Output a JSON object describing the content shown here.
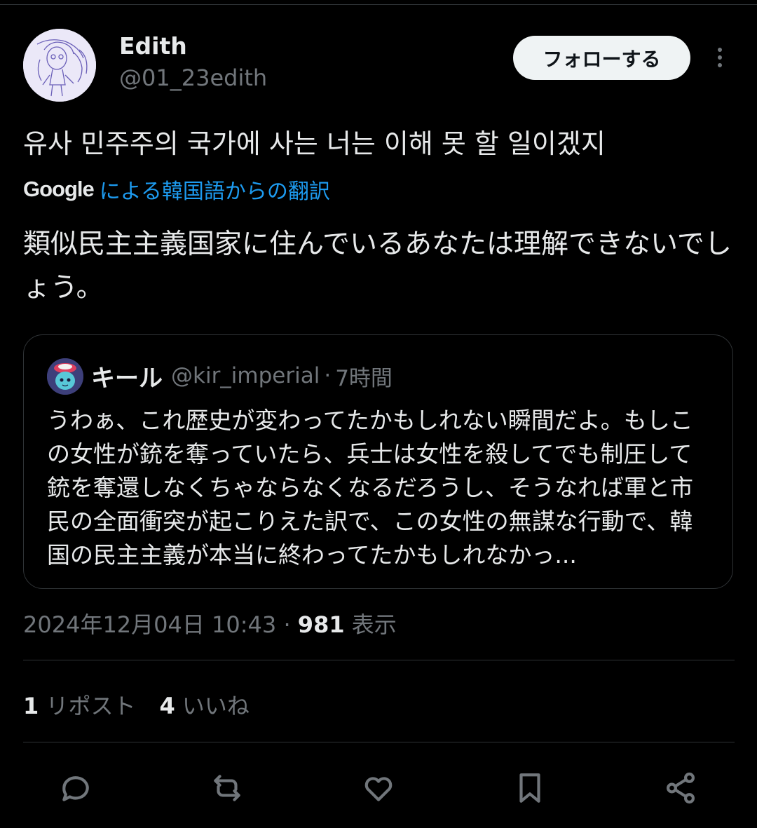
{
  "author": {
    "name": "Edith",
    "handle": "@01_23edith"
  },
  "follow_label": "フォローする",
  "tweet": {
    "original_text": "유사 민주주의 국가에 사는 너는 이해 못 할 일이겠지",
    "translation_provider": "Google",
    "translation_link": "による韓国語からの翻訳",
    "translated_text": "類似民主主義国家に住んでいるあなたは理解できないでしょう。"
  },
  "quote": {
    "name": "キール",
    "handle": "@kir_imperial",
    "separator": "·",
    "time": "7時間",
    "text": "うわぁ、これ歴史が変わってたかもしれない瞬間だよ。もしこの女性が銃を奪っていたら、兵士は女性を殺してでも制圧して銃を奪還しなくちゃならなくなるだろうし、そうなれば軍と市民の全面衝突が起こりえた訳で、この女性の無謀な行動で、韓国の民主主義が本当に終わってたかもしれなかっ..."
  },
  "meta": {
    "timestamp": "2024年12月04日 10:43",
    "separator": " · ",
    "views_count": "981",
    "views_label": " 表示"
  },
  "stats": {
    "reposts_count": "1",
    "reposts_label": " リポスト",
    "likes_count": "4",
    "likes_label": " いいね"
  },
  "actions": [
    "reply-icon",
    "repost-icon",
    "like-icon",
    "bookmark-icon",
    "share-icon"
  ],
  "colors": {
    "background": "#000000",
    "text": "#e7e9ea",
    "secondary": "#71767b",
    "link": "#1d9bf0",
    "border": "#2f3336"
  }
}
